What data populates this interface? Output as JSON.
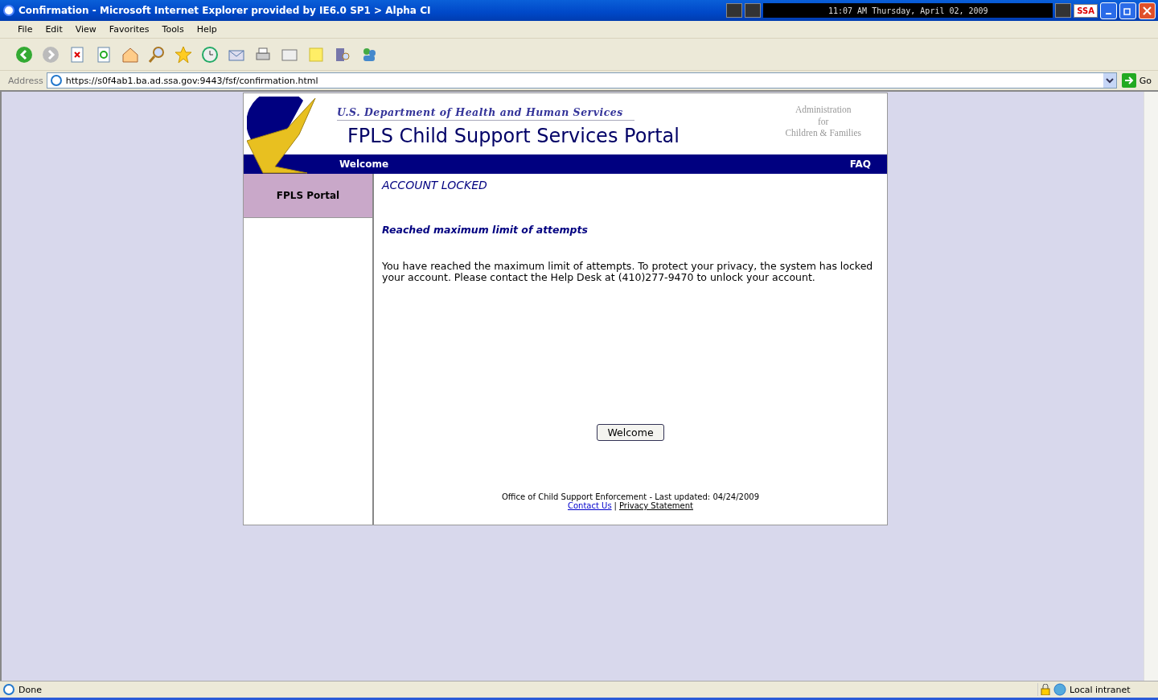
{
  "window": {
    "title": "Confirmation - Microsoft Internet Explorer provided by IE6.0 SP1  > Alpha CI",
    "clock": "11:07 AM Thursday, April 02, 2009",
    "badge": "SSA"
  },
  "menu": [
    "File",
    "Edit",
    "View",
    "Favorites",
    "Tools",
    "Help"
  ],
  "address": {
    "label": "Address",
    "value": "https://s0f4ab1.ba.ad.ssa.gov:9443/fsf/confirmation.html",
    "go": "Go"
  },
  "header": {
    "department": "U.S. Department of Health and Human Services",
    "title": "FPLS Child Support Services Portal",
    "agency": [
      "Administration",
      "for",
      "Children & Families"
    ]
  },
  "navbar": {
    "left": "Welcome",
    "right": "FAQ"
  },
  "sidebar": {
    "items": [
      {
        "label": "FPLS Portal",
        "selected": true
      }
    ]
  },
  "content": {
    "heading": "ACCOUNT LOCKED",
    "subheading": "Reached maximum limit of attempts",
    "message": "You have reached the maximum limit of attempts. To protect your privacy, the system has locked your account. Please contact the Help Desk at (410)277-9470 to unlock your account.",
    "button": "Welcome"
  },
  "footer": {
    "text": "Office of Child Support Enforcement - Last updated: 04/24/2009",
    "links": [
      "Contact Us",
      "Privacy Statement"
    ],
    "separator": "|"
  },
  "status_bar": {
    "text": "Done",
    "zone": "Local intranet"
  }
}
